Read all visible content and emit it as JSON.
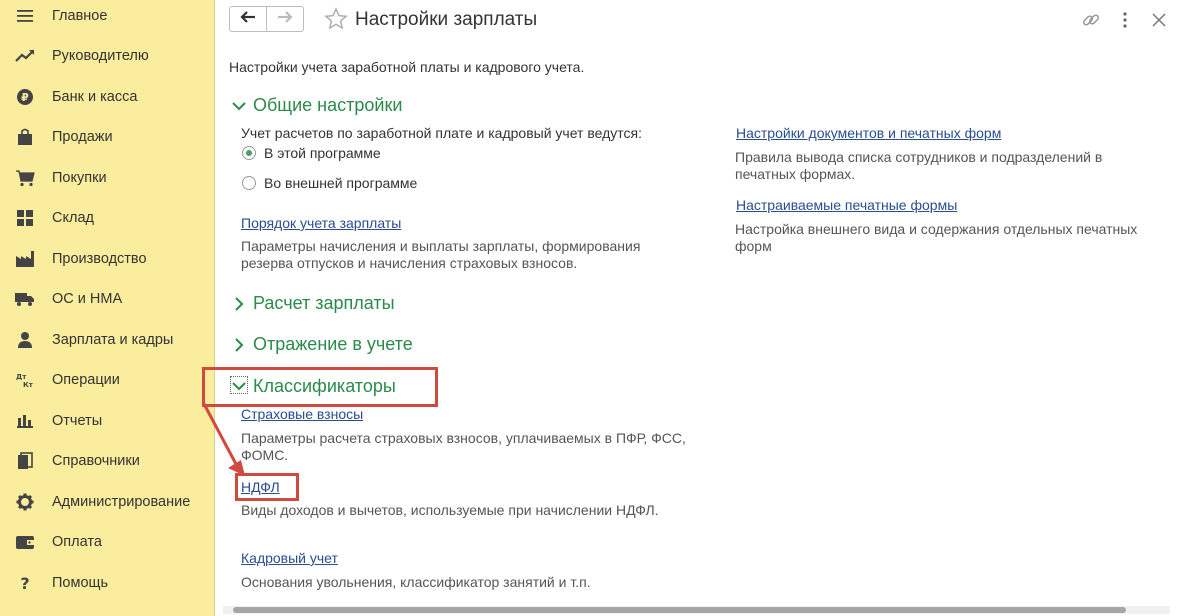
{
  "sidebar": {
    "items": [
      {
        "label": "Главное",
        "icon": "menu-icon"
      },
      {
        "label": "Руководителю",
        "icon": "trend-icon"
      },
      {
        "label": "Банк и касса",
        "icon": "ruble-icon"
      },
      {
        "label": "Продажи",
        "icon": "bag-icon"
      },
      {
        "label": "Покупки",
        "icon": "cart-icon"
      },
      {
        "label": "Склад",
        "icon": "warehouse-icon"
      },
      {
        "label": "Производство",
        "icon": "factory-icon"
      },
      {
        "label": "ОС и НМА",
        "icon": "truck-icon"
      },
      {
        "label": "Зарплата и кадры",
        "icon": "person-icon"
      },
      {
        "label": "Операции",
        "icon": "dt-kt-icon"
      },
      {
        "label": "Отчеты",
        "icon": "bar-chart-icon"
      },
      {
        "label": "Справочники",
        "icon": "books-icon"
      },
      {
        "label": "Администрирование",
        "icon": "gear-icon"
      },
      {
        "label": "Оплата",
        "icon": "wallet-icon"
      },
      {
        "label": "Помощь",
        "icon": "question-icon"
      }
    ]
  },
  "header": {
    "title": "Настройки зарплаты"
  },
  "content": {
    "intro": "Настройки учета заработной платы и кадрового учета.",
    "general": {
      "title": "Общие настройки",
      "question": "Учет расчетов по заработной плате и кадровый учет ведутся:",
      "options": [
        "В этой программе",
        "Во внешней программе"
      ],
      "selected": "В этой программе",
      "salary_link": "Порядок учета зарплаты",
      "salary_desc": "Параметры начисления и выплаты зарплаты, формирования резерва отпусков и начисления страховых взносов.",
      "docs_link": "Настройки документов и печатных форм",
      "docs_desc": "Правила вывода списка сотрудников и подразделений в печатных формах.",
      "print_link": "Настраиваемые печатные формы",
      "print_desc": "Настройка внешнего вида и содержания отдельных печатных форм"
    },
    "payroll": {
      "title": "Расчет зарплаты"
    },
    "reflection": {
      "title": "Отражение в учете"
    },
    "classifiers": {
      "title": "Классификаторы",
      "insurance_link": "Страховые взносы",
      "insurance_desc": "Параметры расчета страховых взносов, уплачиваемых в ПФР, ФСС, ФОМС.",
      "ndfl_link": "НДФЛ",
      "ndfl_desc": "Виды доходов и вычетов, используемые при начислении НДФЛ.",
      "hr_link": "Кадровый учет",
      "hr_desc": "Основания увольнения, классификатор занятий и т.п."
    }
  },
  "colors": {
    "sidebar_bg": "#fbed9e",
    "section_green": "#2b8a4a",
    "link_blue": "#2a4d8f",
    "annotation_red": "#d04a3f"
  }
}
